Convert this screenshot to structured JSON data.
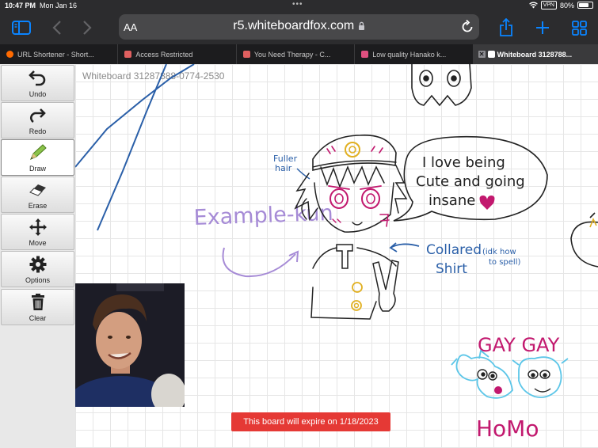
{
  "status_bar": {
    "time": "10:47 PM",
    "date": "Mon Jan 16",
    "vpn": "VPN",
    "battery": "80%"
  },
  "browser": {
    "text_size_button": "AA",
    "url": "r5.whiteboardfox.com",
    "tabs": [
      {
        "title": "URL Shortener - Short...",
        "icon": "shortener-favicon",
        "color": "#ff6a00"
      },
      {
        "title": "Access Restricted",
        "icon": "robot-favicon",
        "color": "#e06060"
      },
      {
        "title": "You Need Therapy - C...",
        "icon": "robot-favicon",
        "color": "#e06060"
      },
      {
        "title": "Low quality Hanako k...",
        "icon": "heart-favicon",
        "color": "#e05080"
      },
      {
        "title": "Whiteboard 3128788...",
        "icon": "whiteboard-favicon",
        "color": "#ffffff",
        "active": true
      }
    ]
  },
  "tools": [
    {
      "label": "Undo",
      "icon": "undo-icon"
    },
    {
      "label": "Redo",
      "icon": "redo-icon"
    },
    {
      "label": "Draw",
      "icon": "pencil-icon",
      "active": true
    },
    {
      "label": "Erase",
      "icon": "eraser-icon"
    },
    {
      "label": "Move",
      "icon": "move-icon"
    },
    {
      "label": "Options",
      "icon": "gear-icon"
    },
    {
      "label": "Clear",
      "icon": "trash-icon"
    }
  ],
  "board": {
    "id_label": "Whiteboard 31287888-0774-2530",
    "expire_notice": "This board will expire on 1/18/2023",
    "annotations": {
      "example": "Example-kun",
      "fuller_hair_1": "Fuller",
      "fuller_hair_2": "hair",
      "speech_1": "I love being",
      "speech_2": "Cute and going",
      "speech_3": "insane",
      "collared_1": "Collared",
      "collared_2": "Shirt",
      "idk_1": "(idk how",
      "idk_2": "to spell)",
      "gay": "GAY GAY",
      "homo": "HoMo"
    }
  },
  "colors": {
    "chrome_dark": "#2c2c2e",
    "accent_blue": "#0a84ff",
    "ink_blue": "#2a5fa8",
    "ink_purple": "#a68bd6",
    "ink_magenta": "#c2186e",
    "ink_cyan": "#5cc6e8",
    "ink_yellow": "#e1b021",
    "expire_red": "#e53935"
  }
}
